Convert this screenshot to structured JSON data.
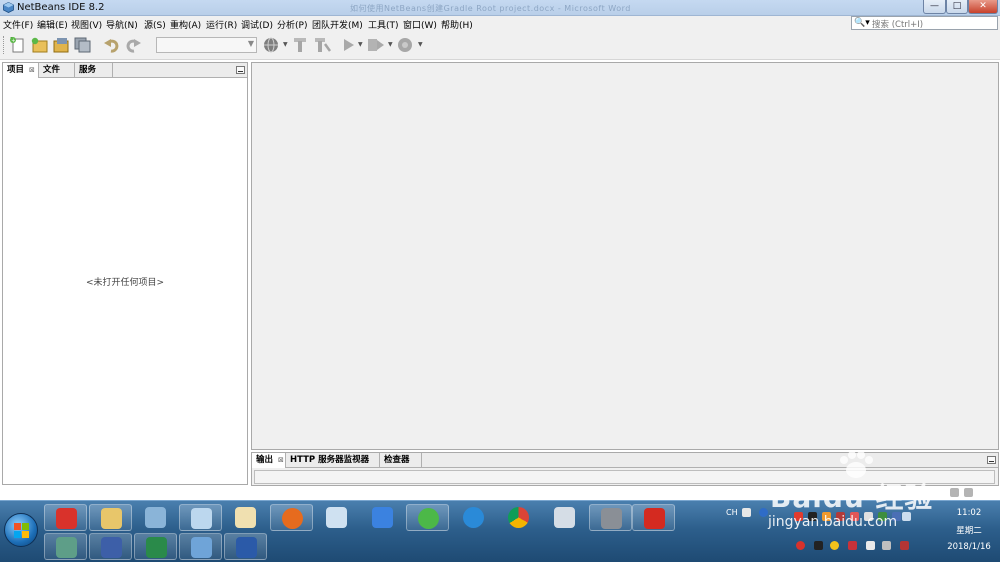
{
  "window": {
    "title": "NetBeans IDE 8.2",
    "background_title": "如何使用NetBeans创建Gradle Root project.docx - Microsoft Word",
    "controls": [
      "—",
      "□",
      "✕"
    ]
  },
  "menubar": {
    "items": [
      "文件(F)",
      "编辑(E)",
      "视图(V)",
      "导航(N)",
      "源(S)",
      "重构(A)",
      "运行(R)",
      "调试(D)",
      "分析(P)",
      "团队开发(M)",
      "工具(T)",
      "窗口(W)",
      "帮助(H)"
    ],
    "search_placeholder": "搜索 (Ctrl+I)"
  },
  "toolbar": {
    "buttons": [
      "new-file-icon",
      "new-project-icon",
      "open-project-icon",
      "save-all-icon",
      "undo-icon",
      "redo-icon",
      "run-config-combo",
      "globe-icon",
      "build-icon",
      "clean-build-icon",
      "run-icon",
      "debug-icon",
      "profile-icon"
    ]
  },
  "left_panel": {
    "tabs": [
      "项目",
      "文件",
      "服务"
    ],
    "active_tab": "项目",
    "empty_message": "<未打开任何项目>"
  },
  "output_panel": {
    "tabs": [
      "输出",
      "HTTP 服务器监视器",
      "检查器"
    ]
  },
  "taskbar": {
    "tray_lang": "CH",
    "time": "11:02",
    "weekday": "星期二",
    "date": "2018/1/16",
    "colors": {
      "taskbar": "#2d5f8c",
      "accent": "#1d6fb8"
    }
  },
  "watermark": {
    "logo_text": "Baidu 经验",
    "url": "jingyan.baidu.com"
  }
}
